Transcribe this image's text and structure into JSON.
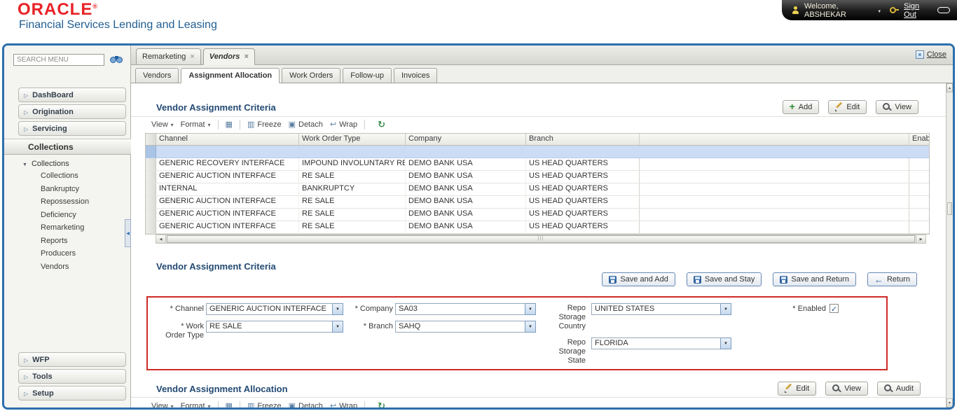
{
  "header": {
    "logo": "ORACLE",
    "logo_mark": "®",
    "subtitle": "Financial Services Lending and Leasing",
    "welcome": "Welcome, ABSHEKAR",
    "sign_out": "Sign Out"
  },
  "sidebar": {
    "search_placeholder": "SEARCH MENU",
    "items": [
      {
        "label": "DashBoard"
      },
      {
        "label": "Origination"
      },
      {
        "label": "Servicing"
      }
    ],
    "section_header": "Collections",
    "tree": {
      "root": "Collections",
      "children": [
        "Collections",
        "Bankruptcy",
        "Repossession",
        "Deficiency",
        "Remarketing",
        "Reports",
        "Producers",
        "Vendors"
      ]
    },
    "bottom_items": [
      {
        "label": "WFP"
      },
      {
        "label": "Tools"
      },
      {
        "label": "Setup"
      }
    ]
  },
  "window_tabs": {
    "tabs": [
      {
        "label": "Remarketing"
      },
      {
        "label": "Vendors"
      }
    ],
    "close_label": "Close"
  },
  "subtabs": [
    "Vendors",
    "Assignment Allocation",
    "Work Orders",
    "Follow-up",
    "Invoices"
  ],
  "grid": {
    "title": "Vendor Assignment Criteria",
    "buttons": {
      "add": "Add",
      "edit": "Edit",
      "view": "View"
    },
    "toolbar": {
      "view": "View",
      "format": "Format",
      "freeze": "Freeze",
      "detach": "Detach",
      "wrap": "Wrap"
    },
    "columns": {
      "channel": "Channel",
      "work_order_type": "Work Order Type",
      "company": "Company",
      "branch": "Branch",
      "enabled": "Enab"
    },
    "rows": [
      {
        "channel": "",
        "work_order_type": "",
        "company": "",
        "branch": ""
      },
      {
        "channel": "GENERIC RECOVERY INTERFACE",
        "work_order_type": "IMPOUND INVOLUNTARY RE...",
        "company": "DEMO BANK USA",
        "branch": "US HEAD QUARTERS"
      },
      {
        "channel": "GENERIC AUCTION INTERFACE",
        "work_order_type": "RE SALE",
        "company": "DEMO BANK USA",
        "branch": "US HEAD QUARTERS"
      },
      {
        "channel": "INTERNAL",
        "work_order_type": "BANKRUPTCY",
        "company": "DEMO BANK USA",
        "branch": "US HEAD QUARTERS"
      },
      {
        "channel": "GENERIC AUCTION INTERFACE",
        "work_order_type": "RE SALE",
        "company": "DEMO BANK USA",
        "branch": "US HEAD QUARTERS"
      },
      {
        "channel": "GENERIC AUCTION INTERFACE",
        "work_order_type": "RE SALE",
        "company": "DEMO BANK USA",
        "branch": "US HEAD QUARTERS"
      },
      {
        "channel": "GENERIC AUCTION INTERFACE",
        "work_order_type": "RE SALE",
        "company": "DEMO BANK USA",
        "branch": "US HEAD QUARTERS"
      }
    ]
  },
  "form": {
    "title": "Vendor Assignment Criteria",
    "buttons": {
      "save_add": "Save and Add",
      "save_stay": "Save and Stay",
      "save_return": "Save and Return",
      "return_btn": "Return"
    },
    "fields": {
      "channel": {
        "label": "* Channel",
        "value": "GENERIC AUCTION INTERFACE"
      },
      "company": {
        "label": "* Company",
        "value": "SA03"
      },
      "repo_country": {
        "label": "Repo Storage Country",
        "value": "UNITED STATES"
      },
      "enabled": {
        "label": "* Enabled",
        "checked": true
      },
      "work_order_type": {
        "label": "* Work Order Type",
        "value": "RE SALE"
      },
      "branch": {
        "label": "* Branch",
        "value": "SAHQ"
      },
      "repo_state": {
        "label": "Repo Storage State",
        "value": "FLORIDA"
      }
    }
  },
  "allocation": {
    "title": "Vendor Assignment Allocation",
    "buttons": {
      "edit": "Edit",
      "view": "View",
      "audit": "Audit"
    },
    "toolbar": {
      "view": "View",
      "format": "Format",
      "freeze": "Freeze",
      "detach": "Detach",
      "wrap": "Wrap"
    }
  }
}
